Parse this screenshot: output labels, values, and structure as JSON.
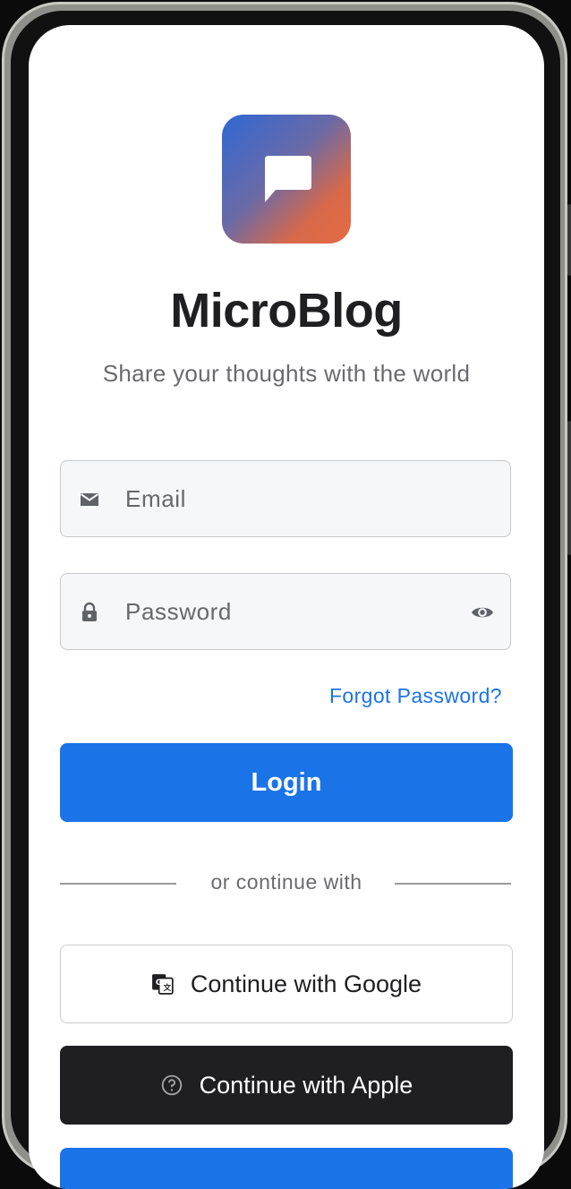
{
  "app": {
    "title": "MicroBlog",
    "subtitle": "Share your thoughts with the world"
  },
  "form": {
    "email": {
      "placeholder": "Email",
      "value": "",
      "icon": "mail-icon"
    },
    "password": {
      "placeholder": "Password",
      "value": "",
      "icon": "lock-icon",
      "toggle_icon": "eye-icon"
    },
    "forgot_label": "Forgot Password?",
    "login_label": "Login"
  },
  "divider": {
    "label": "or continue with"
  },
  "social": {
    "google_label": "Continue with Google",
    "google_icon": "google-translate-icon",
    "apple_label": "Continue with Apple",
    "apple_icon": "help-circle-icon"
  },
  "colors": {
    "primary": "#1b73e8",
    "dark_button": "#1f1f22",
    "logo_gradient": [
      "#2f68d4",
      "#e46a43"
    ]
  }
}
